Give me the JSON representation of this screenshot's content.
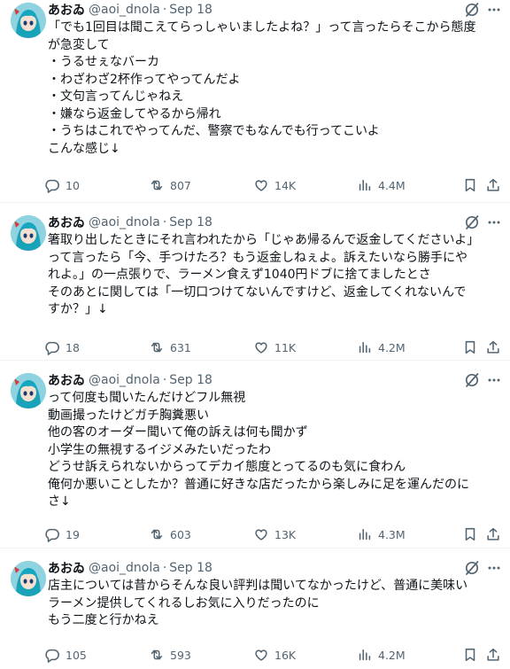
{
  "tweets": [
    {
      "name": "あおゐ",
      "handle": "@aoi_dnola",
      "date": "Sep 18",
      "lines": [
        "「でも1回目は聞こえてらっしゃいましたよね？」って言ったらそこから態度",
        "が急変して",
        "・うるせぇなバーカ",
        "・わざわざ2杯作ってやってんだよ",
        "・文句言ってんじゃねえ",
        "・嫌なら返金してやるから帰れ",
        "・うちはこれでやってんだ、警察でもなんでも行ってこいよ",
        "こんな感じ↓"
      ],
      "replies": "10",
      "reposts": "807",
      "likes": "14K",
      "views": "4.4M"
    },
    {
      "name": "あおゐ",
      "handle": "@aoi_dnola",
      "date": "Sep 18",
      "lines": [
        "箸取り出したときにそれ言われたから「じゃあ帰るんで返金してくださいよ」",
        "って言ったら「今、手つけたろ？もう返金しねぇよ。訴えたいなら勝手にや",
        "れよ。」の一点張りで、ラーメン食えず1040円ドブに捨てましたとさ",
        "そのあとに関しては「一切口つけてないんですけど、返金してくれないんで",
        "すか？」↓"
      ],
      "replies": "18",
      "reposts": "631",
      "likes": "11K",
      "views": "4.2M"
    },
    {
      "name": "あおゐ",
      "handle": "@aoi_dnola",
      "date": "Sep 18",
      "lines": [
        "って何度も聞いたんだけどフル無視",
        "動画撮ったけどガチ胸糞悪い",
        "他の客のオーダー聞いて俺の訴えは何も聞かず",
        "小学生の無視するイジメみたいだったわ",
        "どうせ訴えられないからってデカイ態度とってるのも気に食わん",
        "俺何か悪いことしたか？普通に好きな店だったから楽しみに足を運んだのに",
        "さ↓"
      ],
      "replies": "19",
      "reposts": "603",
      "likes": "13K",
      "views": "4.3M"
    },
    {
      "name": "あおゐ",
      "handle": "@aoi_dnola",
      "date": "Sep 18",
      "lines": [
        "店主については昔からそんな良い評判は聞いてなかったけど、普通に美味い",
        "ラーメン提供してくれるしお気に入りだったのに",
        "もう二度と行かねえ"
      ],
      "replies": "105",
      "reposts": "593",
      "likes": "16K",
      "views": "4.2M"
    }
  ],
  "separator": "·",
  "icons": {
    "grok": "grok-icon",
    "more": "more-icon",
    "reply": "reply-icon",
    "repost": "repost-icon",
    "like": "like-icon",
    "views": "views-icon",
    "bookmark": "bookmark-icon",
    "share": "share-icon"
  },
  "colors": {
    "text": "#0f1419",
    "secondary": "#536471",
    "divider": "#eff3f4"
  }
}
